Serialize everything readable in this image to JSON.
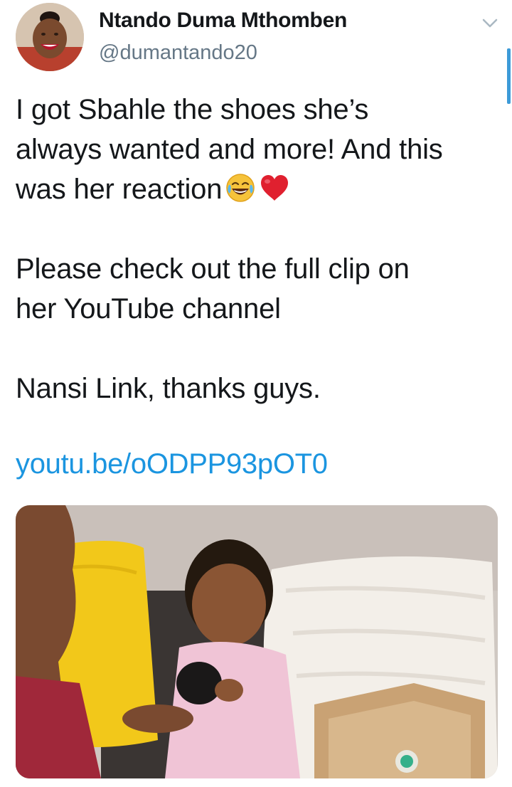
{
  "author": {
    "name": "Ntando Duma Mthomben",
    "handle": "@dumantando20"
  },
  "tweet": {
    "lines": [
      "I got Sbahle the shoes she’s",
      "always wanted and more! And this",
      "was her reaction"
    ],
    "emojis": [
      "face-with-tears-of-joy",
      "red-heart"
    ],
    "paragraph2": [
      "Please check out the full clip on",
      "her YouTube channel"
    ],
    "paragraph3": "Nansi Link, thanks guys.",
    "link": "youtu.be/oODPP93pOT0"
  },
  "colors": {
    "link": "#1b95e0",
    "name": "#14171a",
    "handle": "#657786",
    "scrollbar": "#3d9bd8"
  },
  "icons": {
    "caret": "chevron-down-icon"
  }
}
